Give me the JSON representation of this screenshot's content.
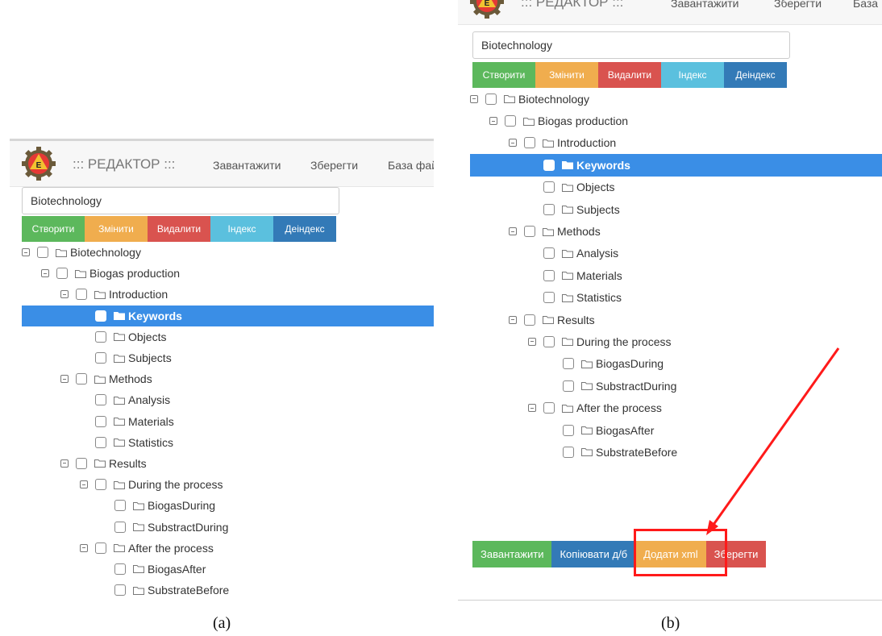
{
  "captions": {
    "a": "(a)",
    "b": "(b)"
  },
  "colors": {
    "create": "#5cb85c",
    "edit": "#f0ad4e",
    "delete": "#d9534f",
    "index": "#5bc0de",
    "deindex": "#337ab7",
    "selected": "#3a8ee6",
    "annotation": "#ff1a1a"
  },
  "panel_a": {
    "brand": "::: РЕДАКТОР :::",
    "nav": [
      "Завантажити",
      "Зберегти",
      "База файл"
    ],
    "search_value": "Biotechnology",
    "buttons": [
      "Створити",
      "Змінити",
      "Видалити",
      "Індекс",
      "Деіндекс"
    ]
  },
  "panel_b": {
    "brand": "::: РЕДАКТОР :::",
    "nav": [
      "Завантажити",
      "Зберегти",
      "База"
    ],
    "search_value": "Biotechnology",
    "buttons": [
      "Створити",
      "Змінити",
      "Видалити",
      "Індекс",
      "Деіндекс"
    ],
    "bottom_buttons": [
      "Завантажити",
      "Копіювати д/б",
      "Додати xml",
      "Зберегти"
    ],
    "highlighted_button": "Додати xml"
  },
  "tree": [
    {
      "label": "Biotechnology",
      "level": 0,
      "expanded": true,
      "selected": false
    },
    {
      "label": "Biogas production",
      "level": 1,
      "expanded": true,
      "selected": false
    },
    {
      "label": "Introduction",
      "level": 2,
      "expanded": true,
      "selected": false
    },
    {
      "label": "Keywords",
      "level": 3,
      "expanded": false,
      "selected": true
    },
    {
      "label": "Objects",
      "level": 3,
      "expanded": false,
      "selected": false
    },
    {
      "label": "Subjects",
      "level": 3,
      "expanded": false,
      "selected": false
    },
    {
      "label": "Methods",
      "level": 2,
      "expanded": true,
      "selected": false
    },
    {
      "label": "Analysis",
      "level": 3,
      "expanded": false,
      "selected": false
    },
    {
      "label": "Materials",
      "level": 3,
      "expanded": false,
      "selected": false
    },
    {
      "label": "Statistics",
      "level": 3,
      "expanded": false,
      "selected": false
    },
    {
      "label": "Results",
      "level": 2,
      "expanded": true,
      "selected": false
    },
    {
      "label": "During the process",
      "level": 3,
      "expanded": true,
      "selected": false
    },
    {
      "label": "BiogasDuring",
      "level": 4,
      "expanded": false,
      "selected": false
    },
    {
      "label": "SubstractDuring",
      "level": 4,
      "expanded": false,
      "selected": false
    },
    {
      "label": "After the process",
      "level": 3,
      "expanded": true,
      "selected": false
    },
    {
      "label": "BiogasAfter",
      "level": 4,
      "expanded": false,
      "selected": false
    },
    {
      "label": "SubstrateBefore",
      "level": 4,
      "expanded": false,
      "selected": false
    }
  ]
}
